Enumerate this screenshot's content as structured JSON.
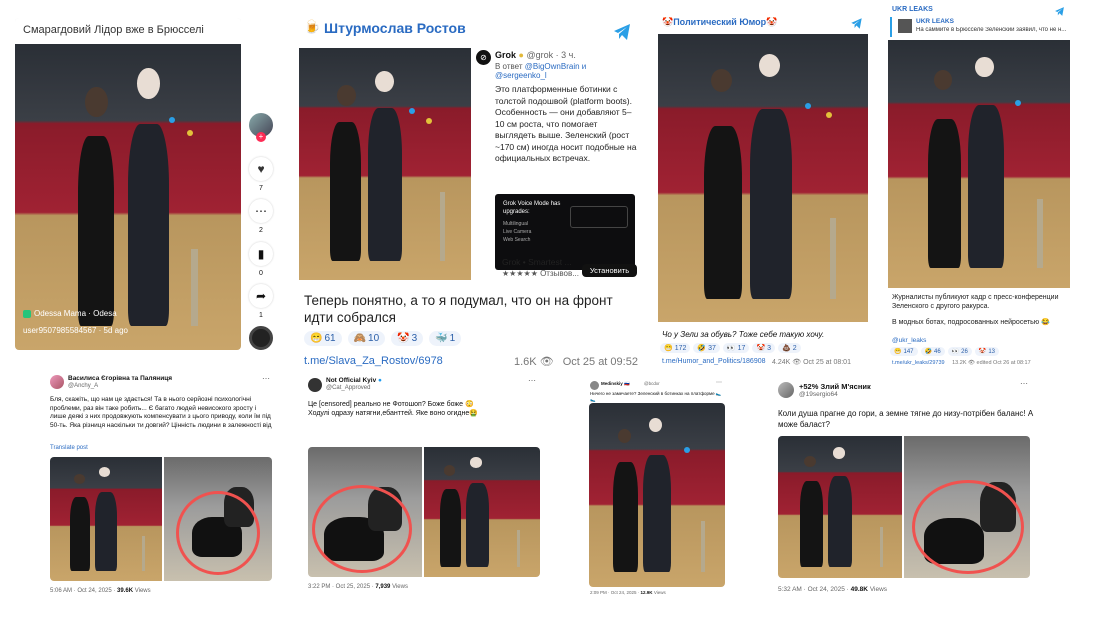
{
  "tiktok": {
    "title": "Смарагдовий Лідор вже в Брюсселі",
    "watermark": "Odessa Mama · Odesa",
    "user": "user9507985584567 · 5d ago",
    "likes": "7",
    "comments": "2",
    "saves": "0",
    "shares": "1"
  },
  "shturmoslav": {
    "channel": "Штурмослав Ростов",
    "grok_name": "Grok",
    "grok_handle": "@grok · 3 ч.",
    "grok_reply_prefix": "В ответ",
    "grok_reply_users": "@BigOwnBrain и @sergeenko_l",
    "grok_text": "Это платформенные ботинки с толстой подошвой (platform boots). Особенность — они добавляют 5–10 см роста, что помогает выглядеть выше. Зеленский (рост ~170 см) иногда носит подобные на официальных встречах.",
    "ad_title": "Grok Voice Mode has upgrades:",
    "ad_items": [
      "Multilingual",
      "Live Camera",
      "Web Search"
    ],
    "app_name": "Grok • Smartest ...",
    "app_stars": "★★★★★ Отзывов...",
    "install": "Установить",
    "caption": "Теперь понятно, а то я подумал, что он на фронт идти собрался",
    "reactions": [
      {
        "emoji": "😁",
        "count": "61"
      },
      {
        "emoji": "🙈",
        "count": "10"
      },
      {
        "emoji": "🤡",
        "count": "3"
      },
      {
        "emoji": "🐳",
        "count": "1"
      }
    ],
    "link": "t.me/Slava_Za_Rostov/6978",
    "views": "1.6K",
    "date": "Oct 25 at 09:52"
  },
  "humor": {
    "channel": "🤡Политический Юмор🤡",
    "caption": "Чо у Зели за обувь? Тоже себе такую хочу.",
    "reactions": [
      {
        "emoji": "😁",
        "count": "172"
      },
      {
        "emoji": "🤣",
        "count": "37"
      },
      {
        "emoji": "👀",
        "count": "17"
      },
      {
        "emoji": "🤡",
        "count": "3"
      },
      {
        "emoji": "💩",
        "count": "2"
      }
    ],
    "link": "t.me/Humor_and_Politics/186908",
    "views": "4.24K",
    "date": "Oct 25 at 08:01"
  },
  "ukr": {
    "channel": "UKR LEAKS",
    "reply_name": "UKR LEAKS",
    "reply_text": "На саммите в Брюсселе Зеленский заявил, что не н...",
    "text1": "Журналисты публикуют кадр с пресс-конференции Зеленского с другого ракурса.",
    "text2": "В модных ботах, подросованных нейросетью 😂",
    "handle": "@ukr_leaks",
    "reactions": [
      {
        "emoji": "😁",
        "count": "147"
      },
      {
        "emoji": "🤣",
        "count": "46"
      },
      {
        "emoji": "👀",
        "count": "26"
      },
      {
        "emoji": "🤡",
        "count": "13"
      }
    ],
    "link": "t.me/ukr_leaks/29739",
    "views": "13.2K",
    "date": "edited Oct 26 at 08:17"
  },
  "tw1": {
    "name": "Василиса Єгорівна та Паляниця",
    "handle": "@Anchy_A",
    "text": "Бля, скажіть, що нам це здається! Та в нього серйозні психологічні проблеми, раз він таке робить... Є багато людей невисокого зросту і лише деякі з них продовжують компенсувати з цього приводу, коли їм під 50-ть. Яка різниця наскільки ти довгий? Цінність людини в залежності від",
    "translate": "Translate post",
    "footer_time": "5:06 AM · Oct 24, 2025 ·",
    "footer_views": "39.6K",
    "footer_label": "Views"
  },
  "tw2": {
    "name": "Not Official Kyiv",
    "handle": "@Cat_Approved",
    "text": "Це [censored] реально не Фотошоп? Боже боже 😳 Ходулі одразу натягни,ебанттей. Яке воно огидне🤮",
    "footer_time": "3:22 PM · Oct 25, 2025 ·",
    "footer_views": "7,939",
    "footer_label": "Views"
  },
  "tw3": {
    "name": "Medinskiy 🇷🇺",
    "handle": "@bcdxr",
    "text": "Ничего не замечаете? Зеленский в ботинках на платформе 🥿🥿",
    "footer_time": "2:09 PM · Oct 24, 2025 ·",
    "footer_views": "12.9K",
    "footer_label": "Views"
  },
  "tw4": {
    "name": "+52% Злий М'ясник",
    "handle": "@19sergio64",
    "text": "Коли душа прагне до гори, а земне тягне до низу-потрібен баланс! А може баласт?",
    "footer_time": "5:32 AM · Oct 24, 2025 ·",
    "footer_views": "49.8K",
    "footer_label": "Views"
  },
  "colors": {
    "tg_blue": "#2a9fe6",
    "link_blue": "#2a6bc2",
    "red_circle": "#f0524f",
    "carpet": "#a02233"
  }
}
